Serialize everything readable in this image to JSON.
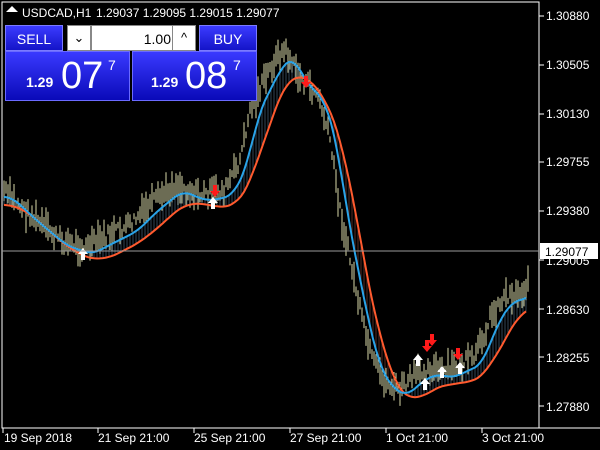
{
  "header": {
    "symbol": "USDCAD,H1",
    "ohlc": "1.29037 1.29095 1.29015 1.29077"
  },
  "trade_panel": {
    "sell_label": "SELL",
    "buy_label": "BUY",
    "lot_value": "1.00",
    "lot_down": "⌄",
    "lot_up": "^",
    "sell_price": {
      "small": "1.29",
      "big": "07",
      "sup": "7"
    },
    "buy_price": {
      "small": "1.29",
      "big": "08",
      "sup": "7"
    }
  },
  "price_axis": {
    "labels": [
      "1.30880",
      "1.30505",
      "1.30130",
      "1.29755",
      "1.29380",
      "1.29005",
      "1.28630",
      "1.28255",
      "1.27880"
    ],
    "current_price": "1.29077"
  },
  "time_axis": {
    "labels": [
      "19 Sep 2018",
      "21 Sep 21:00",
      "25 Sep 21:00",
      "27 Sep 21:00",
      "1 Oct 21:00",
      "3 Oct 21:00"
    ]
  },
  "colors": {
    "background": "#000000",
    "bars": "#d8d8a8",
    "fast_line": "#29a3e8",
    "slow_line": "#ff5a2e",
    "sell_arrow": "#ff1a1a",
    "buy_arrow": "#ffffff",
    "panel_blue": "#2020e0"
  },
  "chart_data": {
    "type": "line",
    "x": [
      "19 Sep 2018",
      "21 Sep 21:00",
      "25 Sep 21:00",
      "27 Sep 21:00",
      "1 Oct 21:00",
      "3 Oct 21:00"
    ],
    "series": [
      {
        "values": [
          1.294,
          1.2912,
          1.2955,
          1.304,
          1.28,
          1.2845
        ]
      },
      {
        "values": [
          1.2955,
          1.2915,
          1.295,
          1.3045,
          1.281,
          1.284
        ]
      }
    ],
    "ylim": [
      1.277,
      1.309
    ]
  }
}
